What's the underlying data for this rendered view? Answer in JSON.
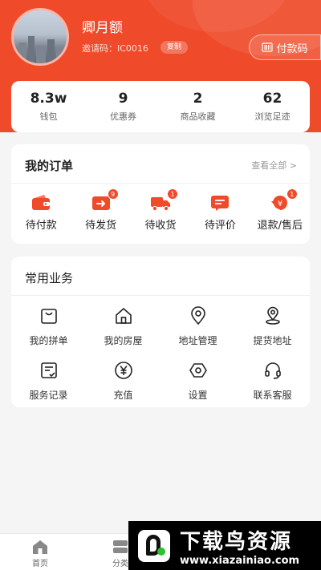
{
  "profile": {
    "name": "卿月额",
    "invite_text": "邀请码：IC0016",
    "copy_label": "复制",
    "paycode_label": "付款码"
  },
  "stats": [
    {
      "value": "8.3w",
      "label": "钱包"
    },
    {
      "value": "9",
      "label": "优惠券"
    },
    {
      "value": "2",
      "label": "商品收藏"
    },
    {
      "value": "62",
      "label": "浏览足迹"
    }
  ],
  "orders": {
    "title": "我的订单",
    "view_all": "查看全部 >",
    "items": [
      {
        "label": "待付款",
        "badge": "",
        "icon": "wallet-icon"
      },
      {
        "label": "待发货",
        "badge": "9",
        "icon": "box-arrow-icon"
      },
      {
        "label": "待收货",
        "badge": "1",
        "icon": "truck-icon"
      },
      {
        "label": "待评价",
        "badge": "",
        "icon": "comment-icon"
      },
      {
        "label": "退款/售后",
        "badge": "1",
        "icon": "refund-icon"
      }
    ]
  },
  "services": {
    "title": "常用业务",
    "items": [
      {
        "label": "我的拼单",
        "icon": "bag-icon"
      },
      {
        "label": "我的房屋",
        "icon": "house-icon"
      },
      {
        "label": "地址管理",
        "icon": "location-pin-icon"
      },
      {
        "label": "提货地址",
        "icon": "pickup-location-icon"
      },
      {
        "label": "服务记录",
        "icon": "record-icon"
      },
      {
        "label": "充值",
        "icon": "yuan-icon"
      },
      {
        "label": "设置",
        "icon": "settings-hex-icon"
      },
      {
        "label": "联系客服",
        "icon": "headset-icon"
      }
    ]
  },
  "tabbar": {
    "items": [
      {
        "label": "首页",
        "icon": "home-icon"
      },
      {
        "label": "分类",
        "icon": "category-icon"
      }
    ]
  },
  "watermark": {
    "title": "下载鸟资源",
    "url": "www.xiazainiao.com"
  },
  "colors": {
    "brand": "#ef4a2a",
    "background": "#f5f5f5"
  }
}
